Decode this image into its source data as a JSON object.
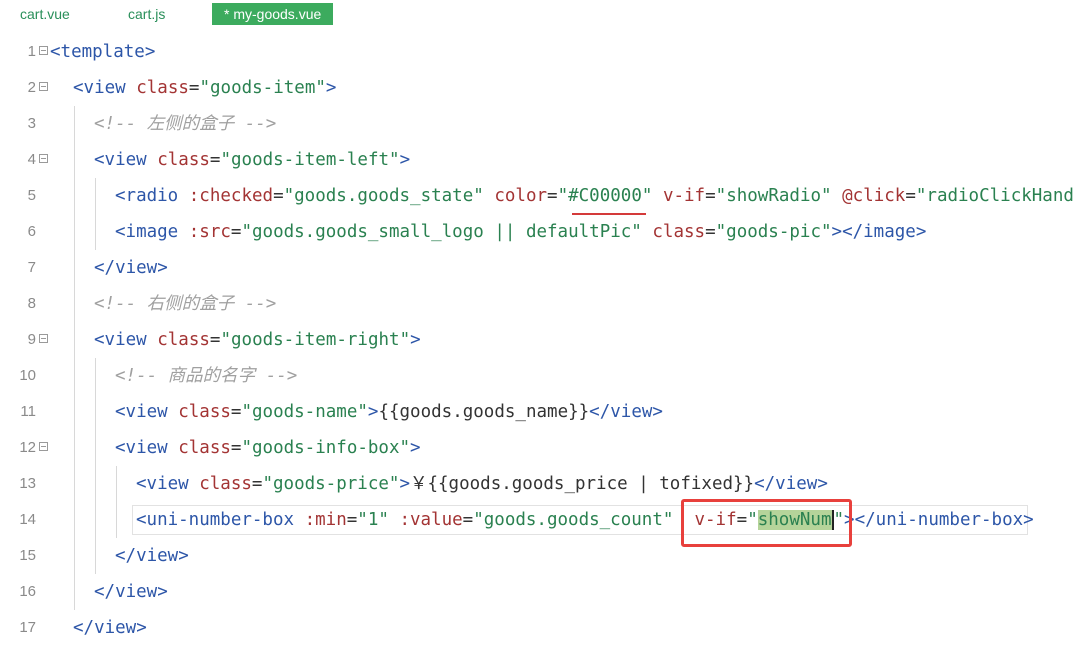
{
  "tabs": [
    {
      "label": "cart.vue",
      "active": false
    },
    {
      "label": "cart.js",
      "active": false
    },
    {
      "label": "* my-goods.vue",
      "active": true
    }
  ],
  "code": {
    "lines": [
      {
        "num": "1"
      },
      {
        "num": "2"
      },
      {
        "num": "3"
      },
      {
        "num": "4"
      },
      {
        "num": "5"
      },
      {
        "num": "6"
      },
      {
        "num": "7"
      },
      {
        "num": "8"
      },
      {
        "num": "9"
      },
      {
        "num": "10"
      },
      {
        "num": "11"
      },
      {
        "num": "12"
      },
      {
        "num": "13"
      },
      {
        "num": "14"
      },
      {
        "num": "15"
      },
      {
        "num": "16"
      },
      {
        "num": "17"
      }
    ],
    "t": {
      "l1_open": "<template>",
      "l2_tag": "<view",
      "l2_attr": "class",
      "l2_eq": "=",
      "l2_val": "\"goods-item\"",
      "l2_close": ">",
      "l3_cmt": "<!-- 左侧的盒子 -->",
      "l4_tag": "<view",
      "l4_attr": "class",
      "l4_eq": "=",
      "l4_val": "\"goods-item-left\"",
      "l4_close": ">",
      "l5_tag": "<radio",
      "l5_a1": ":checked",
      "l5_v1": "\"goods.goods_state\"",
      "l5_a2": "color",
      "l5_v2": "\"#C00000\"",
      "l5_a3": "v-if",
      "l5_v3": "\"showRadio\"",
      "l5_a4": "@click",
      "l5_v4": "\"radioClickHand",
      "l6_tag": "<image",
      "l6_a1": ":src",
      "l6_v1": "\"goods.goods_small_logo || defaultPic\"",
      "l6_a2": "class",
      "l6_v2": "\"goods-pic\"",
      "l6_close": "></image>",
      "l7_tag": "</view>",
      "l8_cmt": "<!-- 右侧的盒子 -->",
      "l9_tag": "<view",
      "l9_attr": "class",
      "l9_val": "\"goods-item-right\"",
      "l9_close": ">",
      "l10_cmt": "<!-- 商品的名字 -->",
      "l11_tag": "<view",
      "l11_attr": "class",
      "l11_val": "\"goods-name\"",
      "l11_close": ">",
      "l11_text": "{{goods.goods_name}}",
      "l11_end": "</view>",
      "l12_tag": "<view",
      "l12_attr": "class",
      "l12_val": "\"goods-info-box\"",
      "l12_close": ">",
      "l13_tag": "<view",
      "l13_attr": "class",
      "l13_val": "\"goods-price\"",
      "l13_close": ">",
      "l13_text": "￥{{goods.goods_price | tofixed}}",
      "l13_end": "</view>",
      "l14_tag": "<uni-number-box",
      "l14_a1": ":min",
      "l14_v1": "\"1\"",
      "l14_a2": ":value",
      "l14_v2": "\"goods.goods_count\"",
      "l14_a3": "v-if",
      "l14_q1": "\"",
      "l14_sel": "showNum",
      "l14_q2": "\"",
      "l14_close": ">",
      "l14_end": "</uni-number-box>",
      "l15_tag": "</view>",
      "l16_tag": "</view>",
      "l17_tag": "</view>"
    }
  },
  "colors": {
    "tab_active_bg": "#3cab5e",
    "tag": "#2d56a8",
    "attribute": "#a33434",
    "string": "#2a8150",
    "comment": "#a0a0a0",
    "highlight_box": "#e8403c",
    "selection": "#b5d49a"
  }
}
